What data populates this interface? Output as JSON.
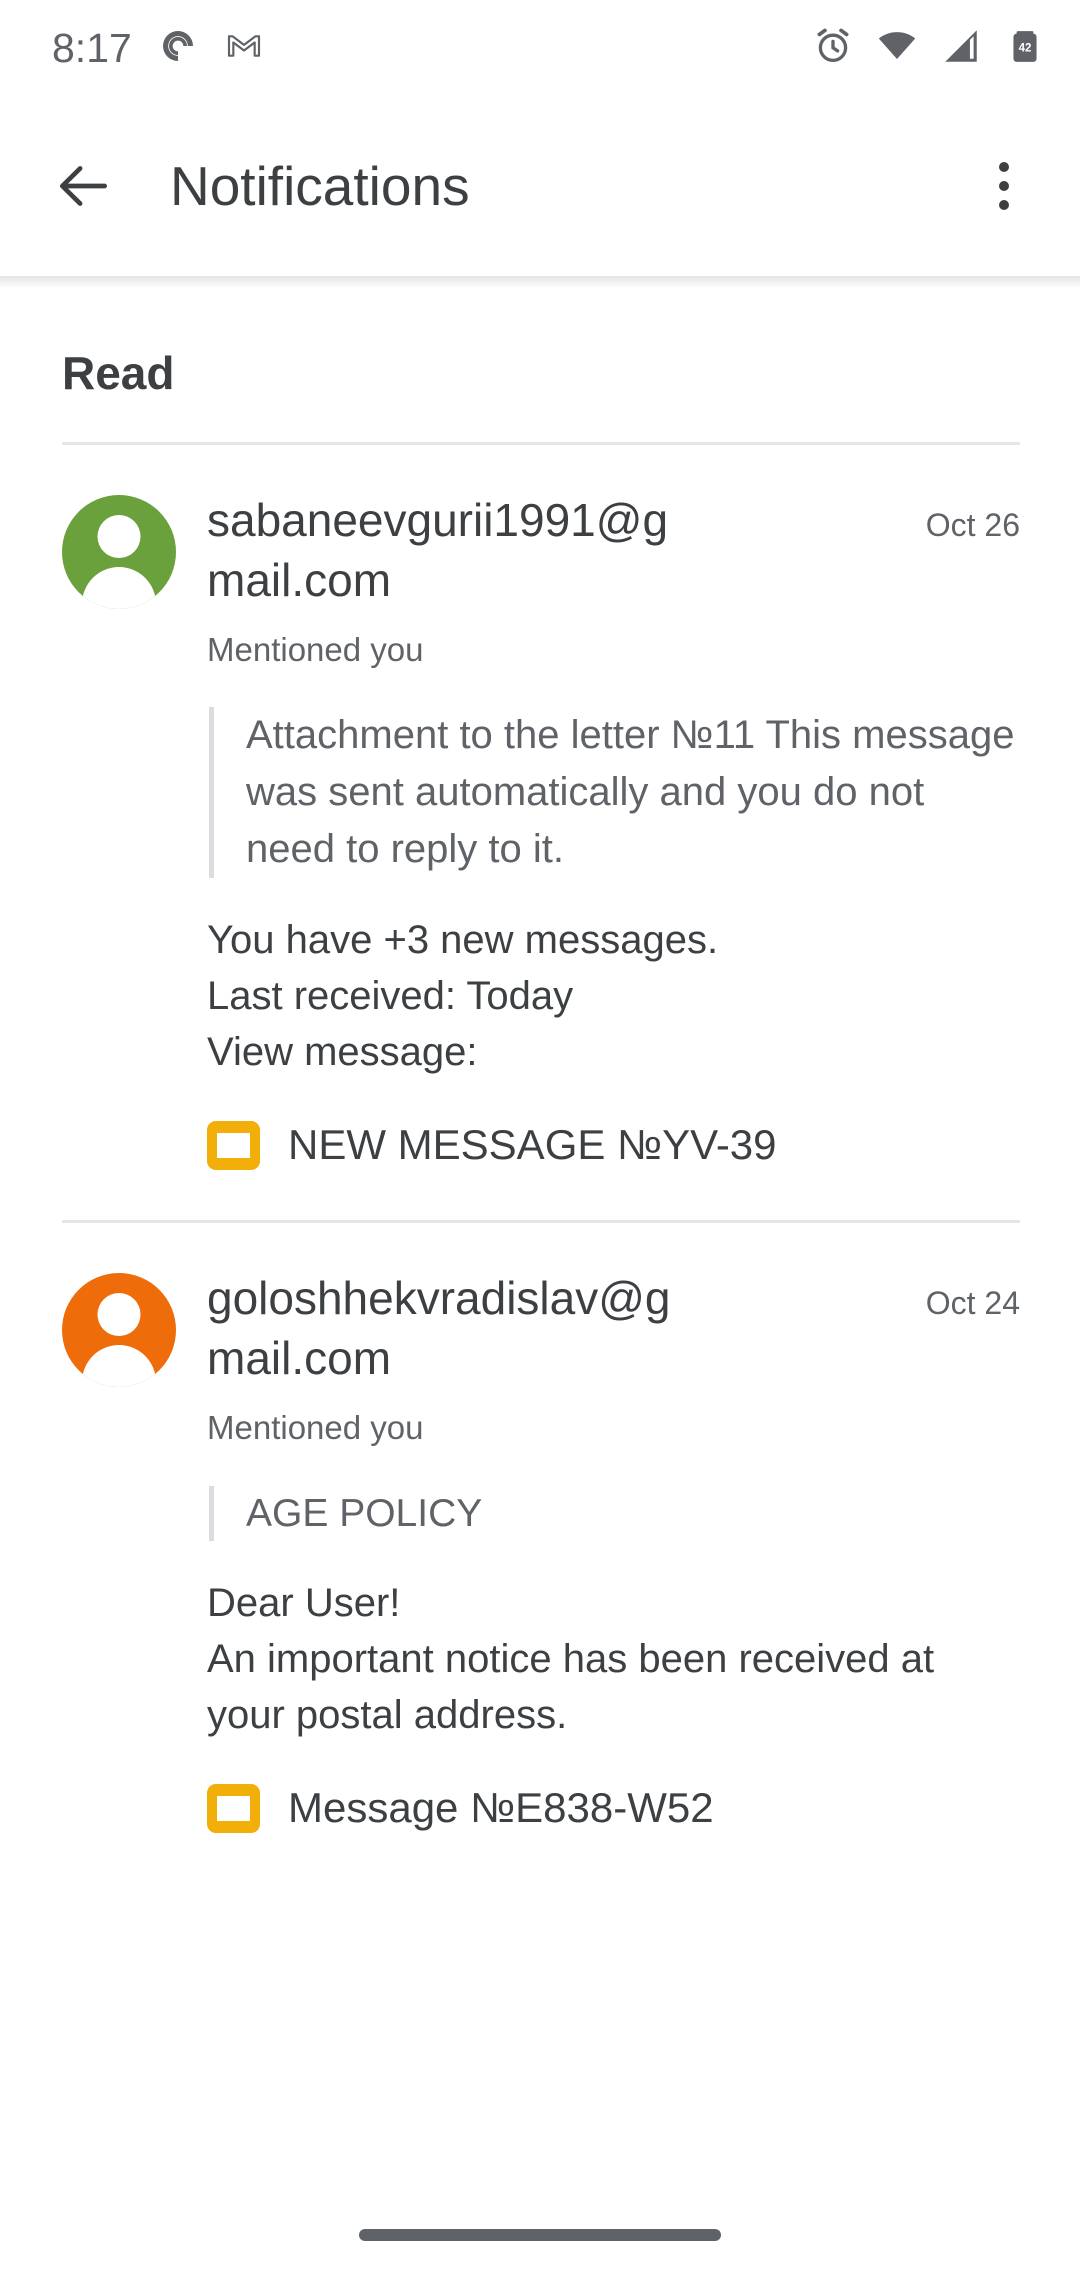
{
  "status_bar": {
    "time": "8:17",
    "left_icons": [
      "pocketcasts-icon",
      "gmail-icon"
    ],
    "right_icons": [
      "alarm-icon",
      "wifi-icon",
      "cellular-signal-icon",
      "battery-icon"
    ],
    "battery_level": "42"
  },
  "app_bar": {
    "back_label": "back-arrow",
    "title": "Notifications",
    "overflow_label": "more-options"
  },
  "content": {
    "section_label": "Read",
    "notifications": [
      {
        "sender": "sabaneevgurii1991@gmail.com",
        "date": "Oct 26",
        "subtitle": "Mentioned you",
        "quote": "Attachment to the letter №11 This message was sent automatically and you do not need to reply to it.",
        "body": "You have +3 new messages.\nLast received: Today\nView message:",
        "action_label": "NEW MESSAGE №YV-39",
        "avatar_color": "#6aa13d",
        "action_icon_color": "#f2ae09"
      },
      {
        "sender": "goloshhekvradislav@gmail.com",
        "date": "Oct 24",
        "subtitle": "Mentioned you",
        "quote": "AGE POLICY",
        "body": "Dear User!\nAn important notice has been received at your postal address.",
        "action_label": "Message №E838-W52",
        "avatar_color": "#ee6c09",
        "action_icon_color": "#f2ae09"
      }
    ]
  },
  "nav_bar": {
    "gesture_pill": "home-gesture-pill"
  }
}
